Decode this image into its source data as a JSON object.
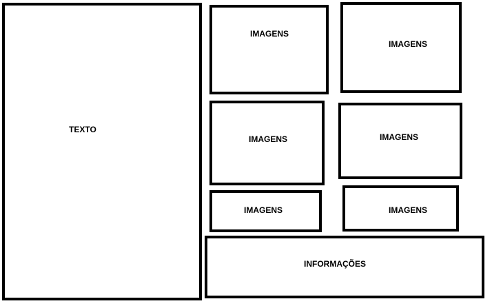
{
  "diagram": {
    "text_block": {
      "label": "TEXTO"
    },
    "image_blocks": [
      {
        "label": "IMAGENS"
      },
      {
        "label": "IMAGENS"
      },
      {
        "label": "IMAGENS"
      },
      {
        "label": "IMAGENS"
      },
      {
        "label": "IMAGENS"
      },
      {
        "label": "IMAGENS"
      }
    ],
    "info_block": {
      "label": "INFORMAÇÕES"
    },
    "colors": {
      "border": "#000000",
      "background": "#ffffff",
      "text": "#000000"
    }
  }
}
